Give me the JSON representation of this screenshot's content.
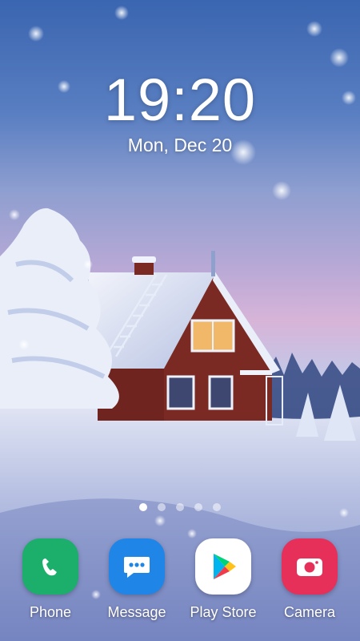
{
  "lockscreen": {
    "time": "19:20",
    "date": "Mon, Dec 20"
  },
  "page_indicator": {
    "total": 5,
    "active_index": 0
  },
  "dock": {
    "apps": [
      {
        "label": "Phone",
        "icon": "phone-icon",
        "color": "#1cae6b"
      },
      {
        "label": "Message",
        "icon": "message-icon",
        "color": "#1f86e8"
      },
      {
        "label": "Play Store",
        "icon": "play-store-icon",
        "color": "#ffffff"
      },
      {
        "label": "Camera",
        "icon": "camera-icon",
        "color": "#e6305a"
      }
    ]
  },
  "wallpaper": {
    "theme": "snowy cabin at dusk",
    "cabin_color": "#7a2a22",
    "window_glow": "#f2b86a"
  }
}
